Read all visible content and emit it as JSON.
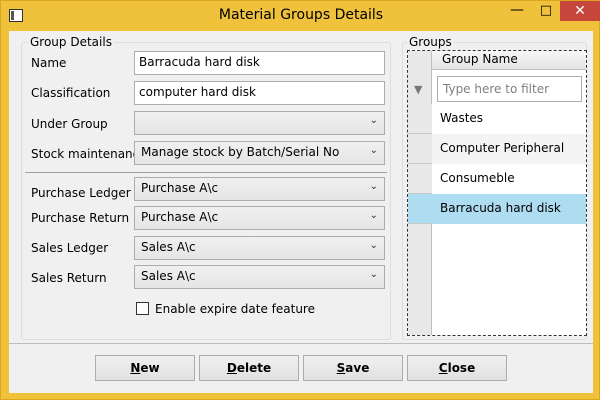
{
  "window": {
    "title": "Material Groups Details"
  },
  "group_details": {
    "legend": "Group Details",
    "name_label": "Name",
    "name_value": "Barracuda hard disk",
    "classification_label": "Classification",
    "classification_value": "computer hard disk",
    "under_group_label": "Under Group",
    "under_group_value": "",
    "stock_label": "Stock maintenance",
    "stock_value": "Manage stock by Batch/Serial No",
    "purchase_ledger_label": "Purchase Ledger",
    "purchase_ledger_value": "Purchase A\\c",
    "purchase_return_label": "Purchase Return",
    "purchase_return_value": "Purchase A\\c",
    "sales_ledger_label": "Sales Ledger",
    "sales_ledger_value": "Sales A\\c",
    "sales_return_label": "Sales Return",
    "sales_return_value": "Sales A\\c",
    "expire_label": "Enable expire date feature"
  },
  "groups": {
    "legend": "Groups",
    "column_header": "Group Name",
    "filter_placeholder": "Type here to filter",
    "rows": [
      "Wastes",
      "Computer Peripheral",
      "Consumeble",
      "Barracuda hard disk"
    ],
    "selected_index": 3
  },
  "buttons": {
    "new_first": "N",
    "new_rest": "ew",
    "delete_first": "D",
    "delete_rest": "elete",
    "save_first": "S",
    "save_rest": "ave",
    "close_first": "C",
    "close_rest": "lose"
  },
  "colors": {
    "window_frame": "#f0c23b",
    "selection": "#aedcf0",
    "close_button": "#c7463b"
  }
}
